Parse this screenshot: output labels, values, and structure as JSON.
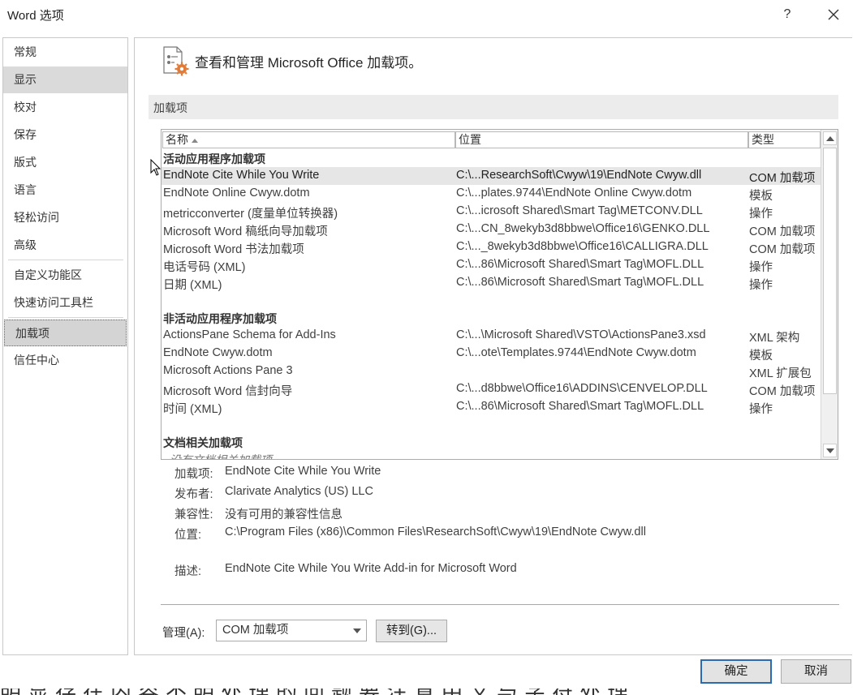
{
  "window": {
    "title": "Word 选项",
    "help": "?",
    "close": "×"
  },
  "nav": {
    "items": [
      {
        "label": "常规"
      },
      {
        "label": "显示"
      },
      {
        "label": "校对"
      },
      {
        "label": "保存"
      },
      {
        "label": "版式"
      },
      {
        "label": "语言"
      },
      {
        "label": "轻松访问"
      },
      {
        "label": "高级"
      },
      {
        "label": "自定义功能区"
      },
      {
        "label": "快速访问工具栏"
      },
      {
        "label": "加载项"
      },
      {
        "label": "信任中心"
      }
    ],
    "hover_index": 1,
    "selected_index": 10
  },
  "header": {
    "text": "查看和管理 Microsoft Office 加载项。",
    "icon": "addins-gear-icon"
  },
  "section": {
    "title": "加载项"
  },
  "list": {
    "columns": [
      "名称",
      "位置",
      "类型"
    ],
    "groups": [
      {
        "label": "活动应用程序加载项",
        "rows": [
          {
            "name": "EndNote Cite While You Write",
            "location": "C:\\...ResearchSoft\\Cwyw\\19\\EndNote Cwyw.dll",
            "type": "COM 加载项",
            "selected": true
          },
          {
            "name": "EndNote Online Cwyw.dotm",
            "location": "C:\\...plates.9744\\EndNote Online Cwyw.dotm",
            "type": "模板"
          },
          {
            "name": "metricconverter (度量单位转换器)",
            "location": "C:\\...icrosoft Shared\\Smart Tag\\METCONV.DLL",
            "type": "操作"
          },
          {
            "name": "Microsoft Word 稿纸向导加载项",
            "location": "C:\\...CN_8wekyb3d8bbwe\\Office16\\GENKO.DLL",
            "type": "COM 加载项"
          },
          {
            "name": "Microsoft Word 书法加载项",
            "location": "C:\\..._8wekyb3d8bbwe\\Office16\\CALLIGRA.DLL",
            "type": "COM 加载项"
          },
          {
            "name": "电话号码 (XML)",
            "location": "C:\\...86\\Microsoft Shared\\Smart Tag\\MOFL.DLL",
            "type": "操作"
          },
          {
            "name": "日期 (XML)",
            "location": "C:\\...86\\Microsoft Shared\\Smart Tag\\MOFL.DLL",
            "type": "操作"
          }
        ]
      },
      {
        "label": "非活动应用程序加载项",
        "rows": [
          {
            "name": "ActionsPane Schema for Add-Ins",
            "location": "C:\\...\\Microsoft Shared\\VSTO\\ActionsPane3.xsd",
            "type": "XML 架构"
          },
          {
            "name": "EndNote Cwyw.dotm",
            "location": "C:\\...ote\\Templates.9744\\EndNote Cwyw.dotm",
            "type": "模板"
          },
          {
            "name": "Microsoft Actions Pane 3",
            "location": "",
            "type": "XML 扩展包"
          },
          {
            "name": "Microsoft Word 信封向导",
            "location": "C:\\...d8bbwe\\Office16\\ADDINS\\CENVELOP.DLL",
            "type": "COM 加载项"
          },
          {
            "name": "时间 (XML)",
            "location": "C:\\...86\\Microsoft Shared\\Smart Tag\\MOFL.DLL",
            "type": "操作"
          }
        ]
      },
      {
        "label": "文档相关加载项",
        "rows": []
      }
    ],
    "cut_off_text": "没有文档相关加载项"
  },
  "details": [
    {
      "label": "加载项:",
      "value": "EndNote Cite While You Write"
    },
    {
      "label": "发布者:",
      "value": "Clarivate Analytics (US) LLC"
    },
    {
      "label": "兼容性:",
      "value": "没有可用的兼容性信息"
    },
    {
      "label": "位置:",
      "value": "C:\\Program Files (x86)\\Common Files\\ResearchSoft\\Cwyw\\19\\EndNote Cwyw.dll"
    },
    {
      "label": "描述:",
      "value": "EndNote Cite While You Write Add-in for Microsoft Word"
    }
  ],
  "manage": {
    "label": "管理(A):",
    "selected": "COM 加载项",
    "goto": "转到(G)..."
  },
  "buttons": {
    "ok": "确定",
    "cancel": "取消"
  },
  "bottom_strip_text": "明显存在内容不明处理的问题要注意中文与字符处理"
}
